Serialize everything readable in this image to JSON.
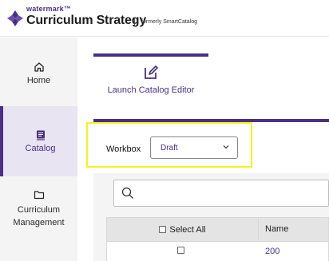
{
  "header": {
    "brand_small": "watermark™",
    "product": "Curriculum Strategy",
    "separator": "|",
    "formerly": "formerly SmartCatalog"
  },
  "sidebar": {
    "items": [
      {
        "label": "Home",
        "icon": "home-icon"
      },
      {
        "label": "Catalog",
        "icon": "catalog-icon",
        "active": true
      },
      {
        "label": "Curriculum\nManagement",
        "icon": "folder-icon"
      }
    ]
  },
  "main": {
    "launch_label": "Launch Catalog Editor",
    "workbox_label": "Workbox",
    "workbox_value": "Draft",
    "search_placeholder": "",
    "table": {
      "select_all": "Select All",
      "name_header": "Name",
      "rows": [
        {
          "name": "200"
        }
      ]
    }
  },
  "colors": {
    "accent": "#4b2f86",
    "highlight": "#f3f316",
    "sidebar_bg": "#f4f4f4"
  }
}
